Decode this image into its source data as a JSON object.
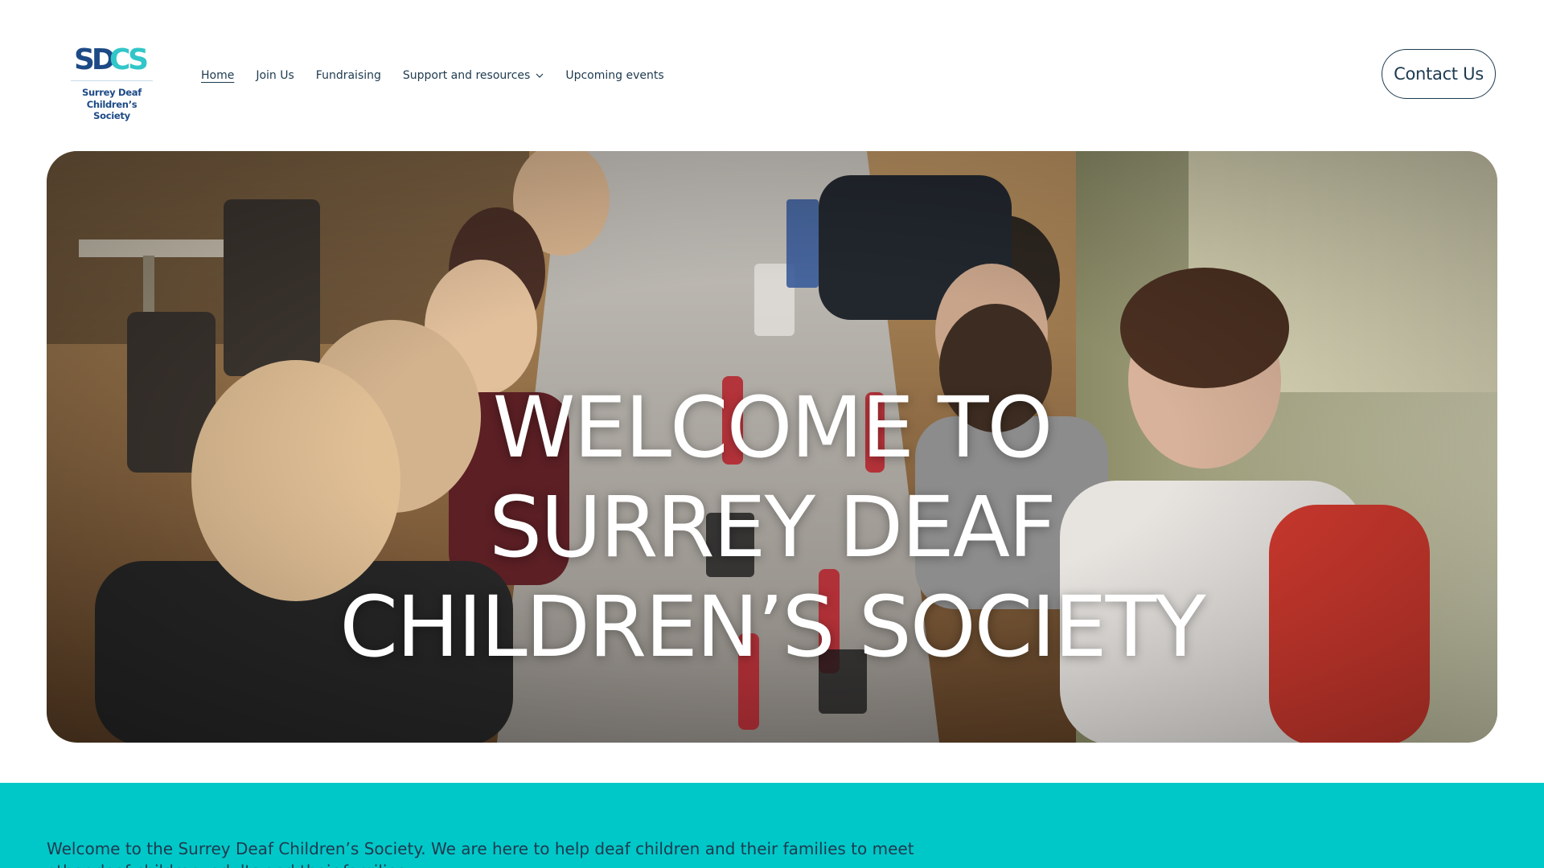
{
  "brand": {
    "logo_mark": "SDCS",
    "line1": "Surrey Deaf",
    "line2": "Children’s Society",
    "colors": {
      "mark_dark": "#1d4a86",
      "mark_teal": "#31c6c9"
    }
  },
  "nav": {
    "items": [
      {
        "label": "Home",
        "active": true
      },
      {
        "label": "Join Us"
      },
      {
        "label": "Fundraising"
      },
      {
        "label": "Support and resources",
        "has_dropdown": true
      },
      {
        "label": "Upcoming events"
      }
    ]
  },
  "header": {
    "contact_label": "Contact Us"
  },
  "hero": {
    "title_lines": [
      "WELCOME TO",
      "SURREY DEAF",
      "CHILDREN’S SOCIETY"
    ],
    "image_alt": "Group of children smiling around a restaurant table"
  },
  "intro": {
    "text": "Welcome to the Surrey Deaf Children’s Society. We are here to help deaf children and their families to meet other deaf children, adults and their families.",
    "background": "#00c8c8"
  },
  "colors": {
    "text": "#1d3a4f",
    "accent": "#00c8c8"
  }
}
